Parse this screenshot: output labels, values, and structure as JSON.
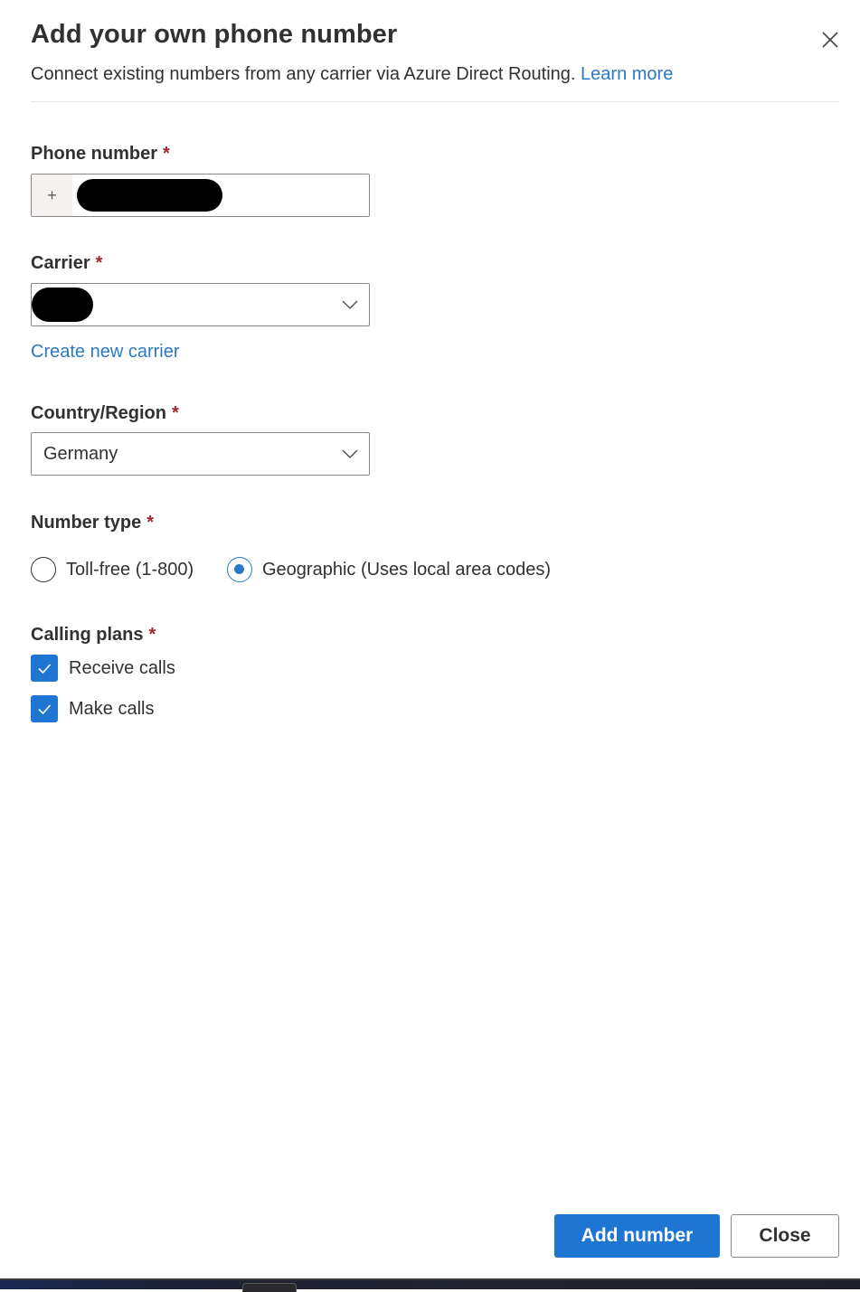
{
  "dialog": {
    "title": "Add your own phone number",
    "subtitle": "Connect existing numbers from any carrier via Azure Direct Routing.",
    "learn_more": "Learn more",
    "close_icon": "close-icon"
  },
  "form": {
    "phone_number": {
      "label": "Phone number",
      "required_mark": "*",
      "prefix": "+",
      "value": "[redacted]"
    },
    "carrier": {
      "label": "Carrier",
      "required_mark": "*",
      "value": "[redacted]",
      "create_link": "Create new carrier"
    },
    "country": {
      "label": "Country/Region",
      "required_mark": "*",
      "value": "Germany"
    },
    "number_type": {
      "label": "Number type",
      "required_mark": "*",
      "options": [
        {
          "label": "Toll-free (1-800)",
          "selected": false
        },
        {
          "label": "Geographic (Uses local area codes)",
          "selected": true
        }
      ]
    },
    "calling_plans": {
      "label": "Calling plans",
      "required_mark": "*",
      "options": [
        {
          "label": "Receive calls",
          "checked": true
        },
        {
          "label": "Make calls",
          "checked": true
        }
      ]
    }
  },
  "footer": {
    "primary": "Add number",
    "secondary": "Close"
  },
  "colors": {
    "accent": "#1f76d2",
    "link": "#2a79c9",
    "required": "#a4262c"
  }
}
